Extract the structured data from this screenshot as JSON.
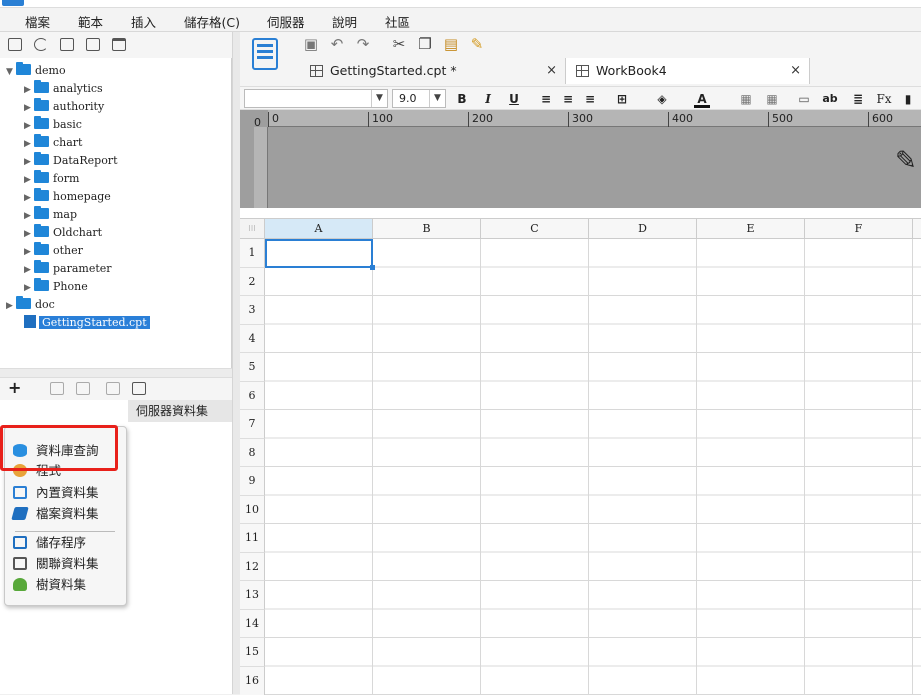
{
  "menu": [
    "檔案",
    "範本",
    "插入",
    "儲存格(C)",
    "伺服器",
    "說明",
    "社區"
  ],
  "tree": {
    "root": "demo",
    "children": [
      "analytics",
      "authority",
      "basic",
      "chart",
      "DataReport",
      "form",
      "homepage",
      "map",
      "Oldchart",
      "other",
      "parameter",
      "Phone"
    ],
    "doc": "doc",
    "file": "GettingStarted.cpt"
  },
  "dataset": {
    "server_tab": "伺服器資料集",
    "menu_items": [
      "資料庫查詢",
      "程式",
      "內置資料集",
      "檔案資料集",
      "儲存程序",
      "關聯資料集",
      "樹資料集"
    ]
  },
  "tabs": [
    {
      "label": "GettingStarted.cpt *",
      "close": "×"
    },
    {
      "label": "WorkBook4",
      "close": "×"
    }
  ],
  "format": {
    "font_size": "9.0"
  },
  "ruler": {
    "zero": "0",
    "ticks": [
      "0",
      "100",
      "200",
      "300",
      "400",
      "500",
      "600"
    ]
  },
  "grid": {
    "columns": [
      "A",
      "B",
      "C",
      "D",
      "E",
      "F"
    ],
    "rows": [
      "1",
      "2",
      "3",
      "4",
      "5",
      "6",
      "7",
      "8",
      "9",
      "10",
      "11",
      "12",
      "13",
      "14",
      "15",
      "16"
    ],
    "selected_cell": "A1"
  },
  "colors": {
    "accent": "#2a7fd4",
    "highlight": "#e8201a"
  }
}
